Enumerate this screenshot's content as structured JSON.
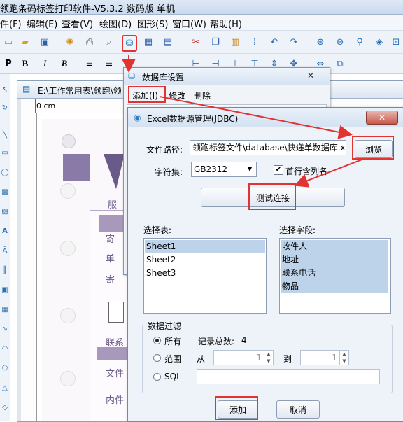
{
  "app": {
    "title": "领跑条码标签打印软件-V5.3.2 数码版 单机",
    "menu": [
      "件(F)",
      "编辑(E)",
      "查看(V)",
      "绘图(D)",
      "图形(S)",
      "窗口(W)",
      "帮助(H)"
    ]
  },
  "toolbar": {
    "format_buttons": [
      "P",
      "B",
      "I",
      "B"
    ]
  },
  "document": {
    "title": "E:\\工作常用表\\领跑\\领",
    "ruler_unit": "0 cm"
  },
  "label_preview": {
    "texts": [
      "服",
      "寄",
      "单",
      "寄",
      "联系",
      "文件",
      "内件"
    ]
  },
  "db_dialog": {
    "title": "数据库设置",
    "menu": [
      "添加(I)",
      "修改",
      "删除"
    ],
    "close": "✕"
  },
  "excel_dialog": {
    "title": "Excel数据源管理(JDBC)",
    "close": "✕",
    "file_path_label": "文件路径:",
    "file_path_value": "领跑标签文件\\database\\快递单数据库.xls",
    "browse_button": "浏览",
    "charset_label": "字符集:",
    "charset_value": "GB2312",
    "header_checkbox_label": "首行含列名",
    "header_checkbox_checked": true,
    "test_button": "测试连接",
    "select_table_label": "选择表:",
    "tables": [
      "Sheet1",
      "Sheet2",
      "Sheet3"
    ],
    "selected_table": "Sheet1",
    "select_field_label": "选择字段:",
    "fields": [
      "收件人",
      "地址",
      "联系电话",
      "物品"
    ],
    "filter_group_label": "数据过滤",
    "filter_all": "所有",
    "record_count_label": "记录总数:",
    "record_count": "4",
    "filter_range": "范围",
    "from_label": "从",
    "from_value": "1",
    "to_label": "到",
    "to_value": "1",
    "filter_sql": "SQL",
    "add_button": "添加",
    "cancel_button": "取消"
  },
  "colors": {
    "highlight_red": "#e23232",
    "selection_blue": "#bcd3ea"
  }
}
